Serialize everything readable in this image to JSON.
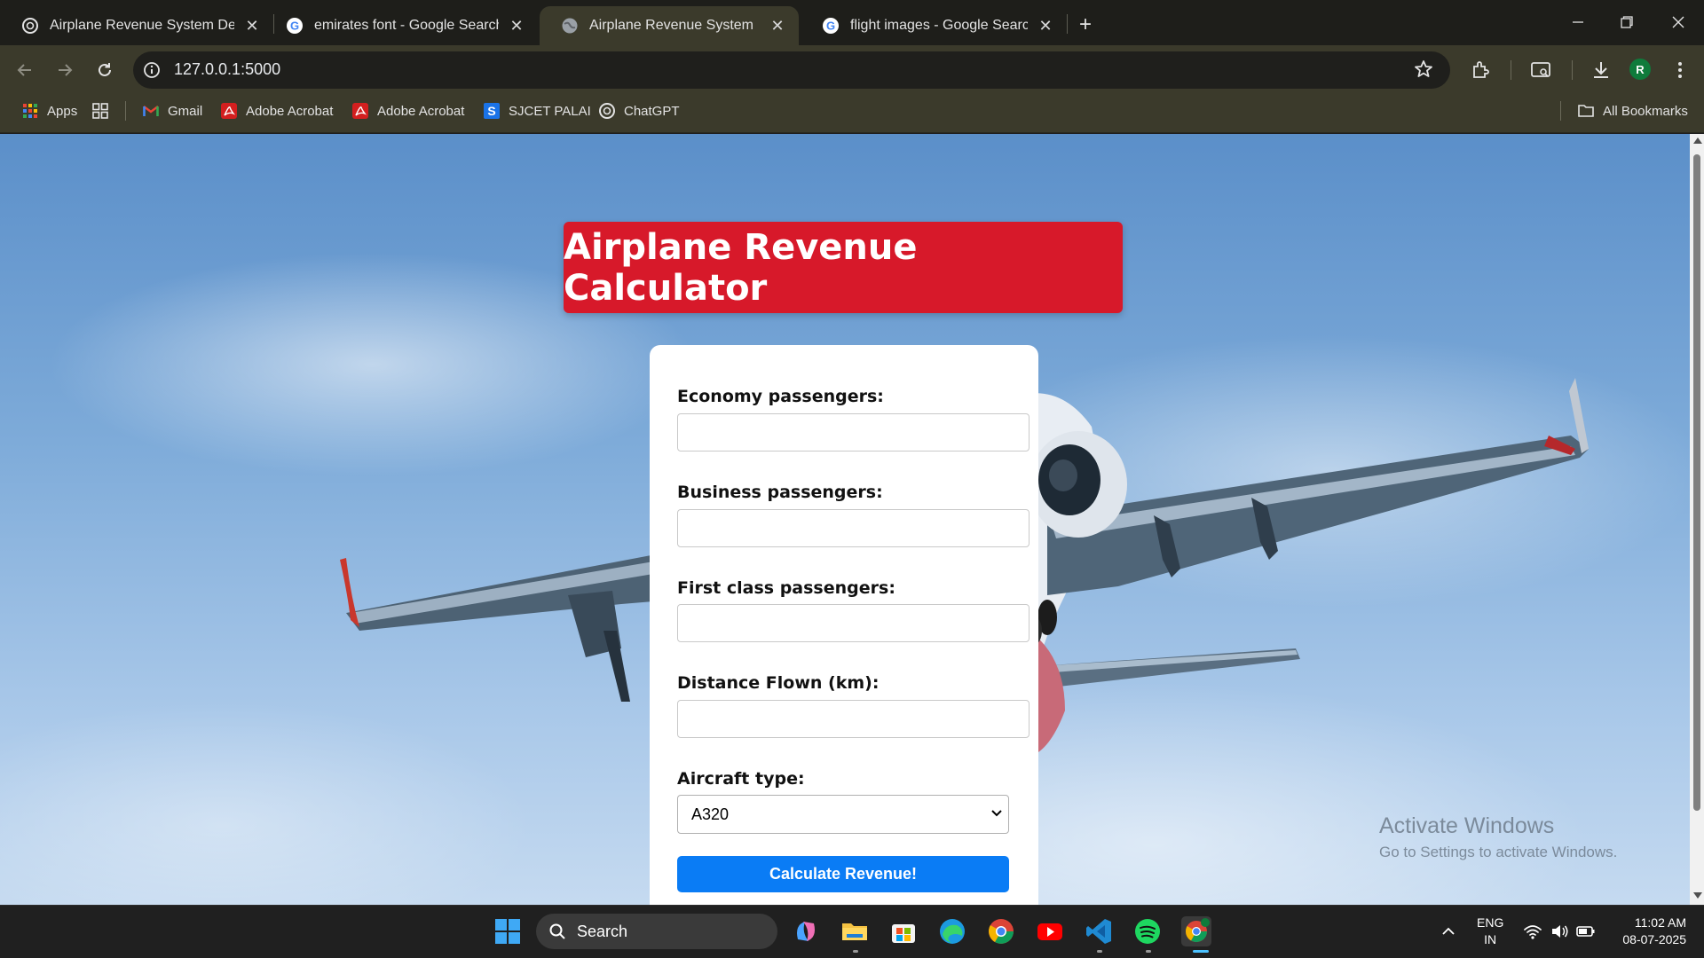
{
  "browser": {
    "tabs": [
      {
        "title": "Airplane Revenue System Devel",
        "icon": "openai-icon",
        "active": false
      },
      {
        "title": "emirates font - Google Search",
        "icon": "google-icon",
        "active": false
      },
      {
        "title": "Airplane Revenue System",
        "icon": "globe-icon",
        "active": true
      },
      {
        "title": "flight images - Google Search",
        "icon": "google-icon",
        "active": false
      }
    ],
    "url": "127.0.0.1:5000",
    "profile_initial": "R",
    "bookmarks": [
      {
        "label": "Apps",
        "icon": "apps-grid-icon"
      },
      {
        "label": "",
        "icon": "tab-groups-icon"
      },
      {
        "label": "Gmail",
        "icon": "gmail-icon"
      },
      {
        "label": "Adobe Acrobat",
        "icon": "acrobat-icon"
      },
      {
        "label": "Adobe Acrobat",
        "icon": "acrobat-icon"
      },
      {
        "label": "SJCET PALAI",
        "icon": "sjcet-icon"
      },
      {
        "label": "ChatGPT",
        "icon": "openai-icon"
      }
    ],
    "all_bookmarks_label": "All Bookmarks"
  },
  "page": {
    "title": "Airplane Revenue Calculator",
    "form": {
      "economy_label": "Economy passengers:",
      "economy_value": "",
      "business_label": "Business passengers:",
      "business_value": "",
      "first_label": "First class passengers:",
      "first_value": "",
      "distance_label": "Distance Flown (km):",
      "distance_value": "",
      "aircraft_label": "Aircraft type:",
      "aircraft_selected": "A320",
      "submit_label": "Calculate Revenue!"
    },
    "colors": {
      "header": "#d7192a",
      "button": "#0a7cf5"
    }
  },
  "watermark": {
    "title": "Activate Windows",
    "subtitle": "Go to Settings to activate Windows."
  },
  "taskbar": {
    "search_label": "Search",
    "apps": [
      "windows-start-icon",
      "copilot-icon",
      "file-explorer-icon",
      "ms-store-icon",
      "edge-icon",
      "chrome-icon",
      "youtube-icon",
      "vscode-icon",
      "spotify-icon",
      "chrome-profile-icon"
    ],
    "lang_line1": "ENG",
    "lang_line2": "IN",
    "time": "11:02 AM",
    "date": "08-07-2025"
  }
}
